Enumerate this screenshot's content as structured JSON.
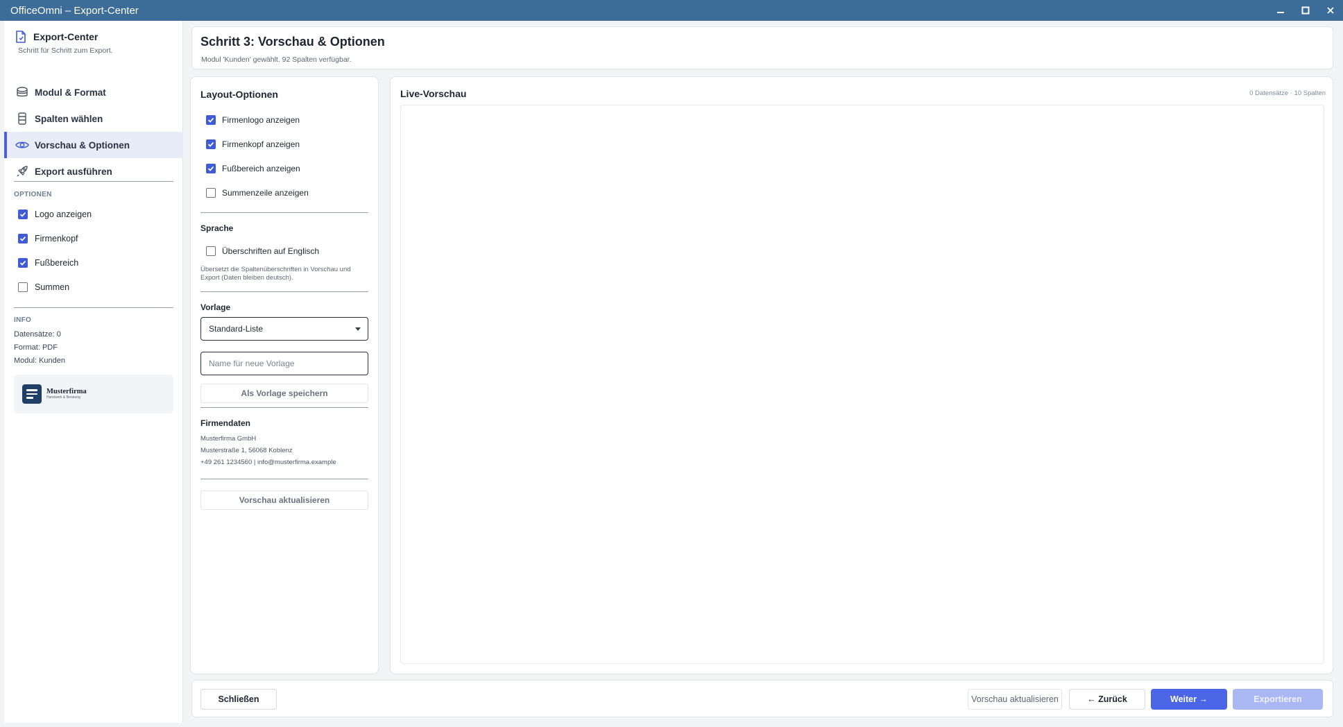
{
  "window": {
    "title": "OfficeOmni – Export-Center"
  },
  "sidebar": {
    "brand_title": "Export-Center",
    "brand_subtitle": "Schritt für Schritt zum Export.",
    "nav": [
      {
        "label": "Modul & Format",
        "icon": "database-icon",
        "active": false
      },
      {
        "label": "Spalten wählen",
        "icon": "columns-icon",
        "active": false
      },
      {
        "label": "Vorschau & Optionen",
        "icon": "eye-icon",
        "active": true
      },
      {
        "label": "Export ausführen",
        "icon": "rocket-icon",
        "active": false
      }
    ],
    "options_label": "OPTIONEN",
    "options": [
      {
        "label": "Logo anzeigen",
        "checked": true
      },
      {
        "label": "Firmenkopf",
        "checked": true
      },
      {
        "label": "Fußbereich",
        "checked": true
      },
      {
        "label": "Summen",
        "checked": false
      }
    ],
    "info_label": "INFO",
    "info": {
      "records": "Datensätze: 0",
      "format": "Format: PDF",
      "module": "Modul: Kunden"
    },
    "logo": {
      "name": "Musterfirma",
      "tagline": "Handwerk & Beratung"
    }
  },
  "header": {
    "title": "Schritt 3: Vorschau & Optionen",
    "subtitle": "Modul 'Kunden' gewählt. 92 Spalten verfügbar."
  },
  "options_panel": {
    "title": "Layout-Optionen",
    "layout_options": [
      {
        "label": "Firmenlogo anzeigen",
        "checked": true
      },
      {
        "label": "Firmenkopf anzeigen",
        "checked": true
      },
      {
        "label": "Fußbereich anzeigen",
        "checked": true
      },
      {
        "label": "Summenzeile anzeigen",
        "checked": false
      }
    ],
    "language_heading": "Sprache",
    "english_headers": {
      "label": "Überschriften auf Englisch",
      "checked": false
    },
    "language_hint": "Übersetzt die Spaltenüberschriften in Vorschau und Export (Daten bleiben deutsch).",
    "template_heading": "Vorlage",
    "template_selected": "Standard-Liste",
    "template_name_placeholder": "Name für neue Vorlage",
    "save_template_label": "Als Vorlage speichern",
    "company_heading": "Firmendaten",
    "company_lines": [
      "Musterfirma GmbH",
      "Musterstraße 1, 56068 Koblenz",
      "+49 261 1234560 | info@musterfirma.example"
    ],
    "refresh_label": "Vorschau aktualisieren"
  },
  "preview": {
    "title": "Live-Vorschau",
    "meta": "0  Datensätze · 10  Spalten"
  },
  "footer": {
    "close_label": "Schließen",
    "refresh_label": "Vorschau aktualisieren",
    "back_label": "← Zurück",
    "next_label": "Weiter →",
    "export_label": "Exportieren"
  },
  "colors": {
    "titlebar": "#3c6d99",
    "accent": "#4a66e6",
    "checkbox": "#3f5bd6",
    "active_nav_bg": "#e8ebf8"
  }
}
